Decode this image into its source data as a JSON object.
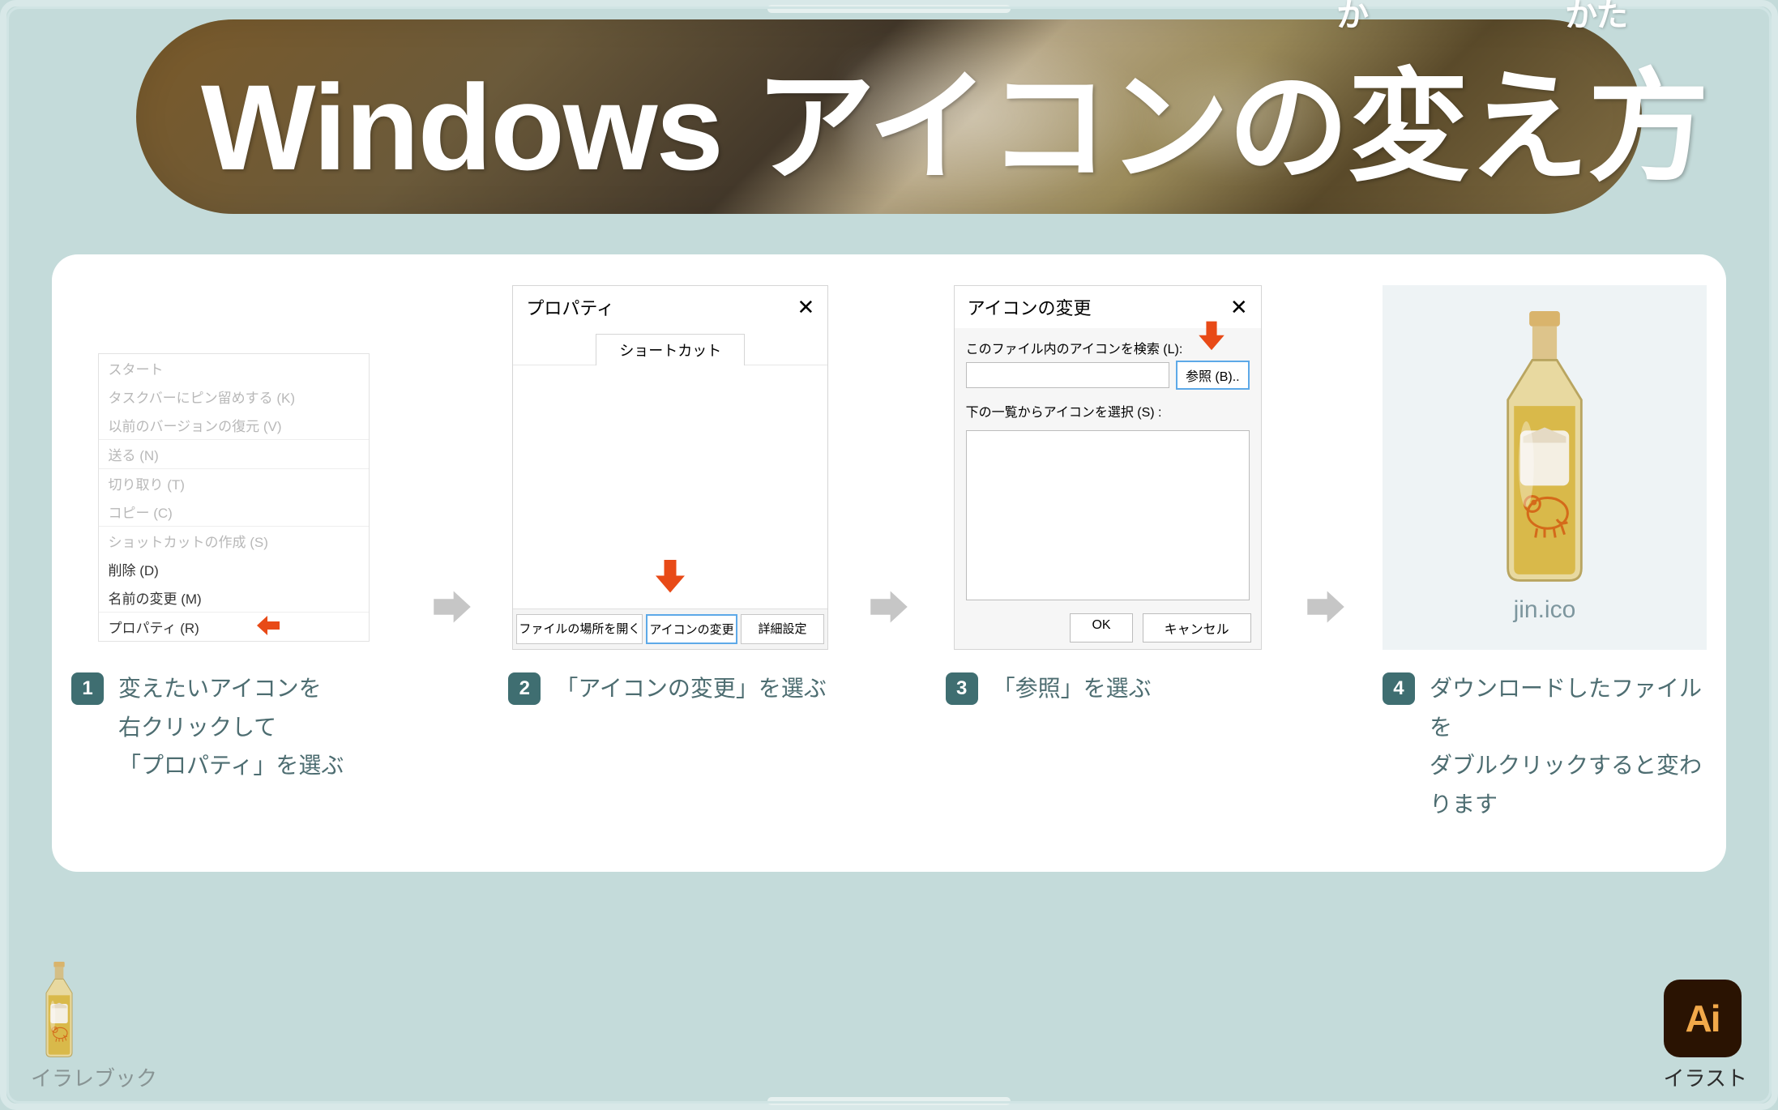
{
  "title": "Windows アイコンの変え方",
  "ruby1": "か",
  "ruby2": "かた",
  "steps": [
    {
      "num": "1",
      "caption": "変えたいアイコンを\n右クリックして\n「プロパティ」を選ぶ"
    },
    {
      "num": "2",
      "caption": "「アイコンの変更」を選ぶ"
    },
    {
      "num": "3",
      "caption": "「参照」を選ぶ"
    },
    {
      "num": "4",
      "caption": "ダウンロードしたファイルを\nダブルクリックすると変わります"
    }
  ],
  "context_menu": {
    "items": [
      {
        "label": "スタート"
      },
      {
        "label": "タスクバーにピン留めする (K)"
      },
      {
        "label": "以前のバージョンの復元 (V)"
      },
      {
        "label": "送る (N)",
        "sep": true
      },
      {
        "label": "切り取り (T)",
        "sep": true
      },
      {
        "label": "コピー (C)"
      },
      {
        "label": "ショットカットの作成 (S)",
        "sep": true
      },
      {
        "label": "削除 (D)",
        "emph": true
      },
      {
        "label": "名前の変更 (M)",
        "emph": true
      },
      {
        "label": "プロパティ (R)",
        "highlight": true,
        "sep": true
      }
    ]
  },
  "properties_dialog": {
    "title": "プロパティ",
    "tab": "ショートカット",
    "buttons": {
      "open_location": "ファイルの場所を開く",
      "change_icon": "アイコンの変更",
      "advanced": "詳細設定"
    }
  },
  "change_icon_dialog": {
    "title": "アイコンの変更",
    "search_label": "このファイル内のアイコンを検索 (L):",
    "browse": "参照 (B)..",
    "select_label": "下の一覧からアイコンを選択 (S) :",
    "ok": "OK",
    "cancel": "キャンセル"
  },
  "result": {
    "filename": "jin.ico"
  },
  "footer": {
    "left": "イラレブック",
    "right": "イラスト",
    "ai": "Ai"
  }
}
